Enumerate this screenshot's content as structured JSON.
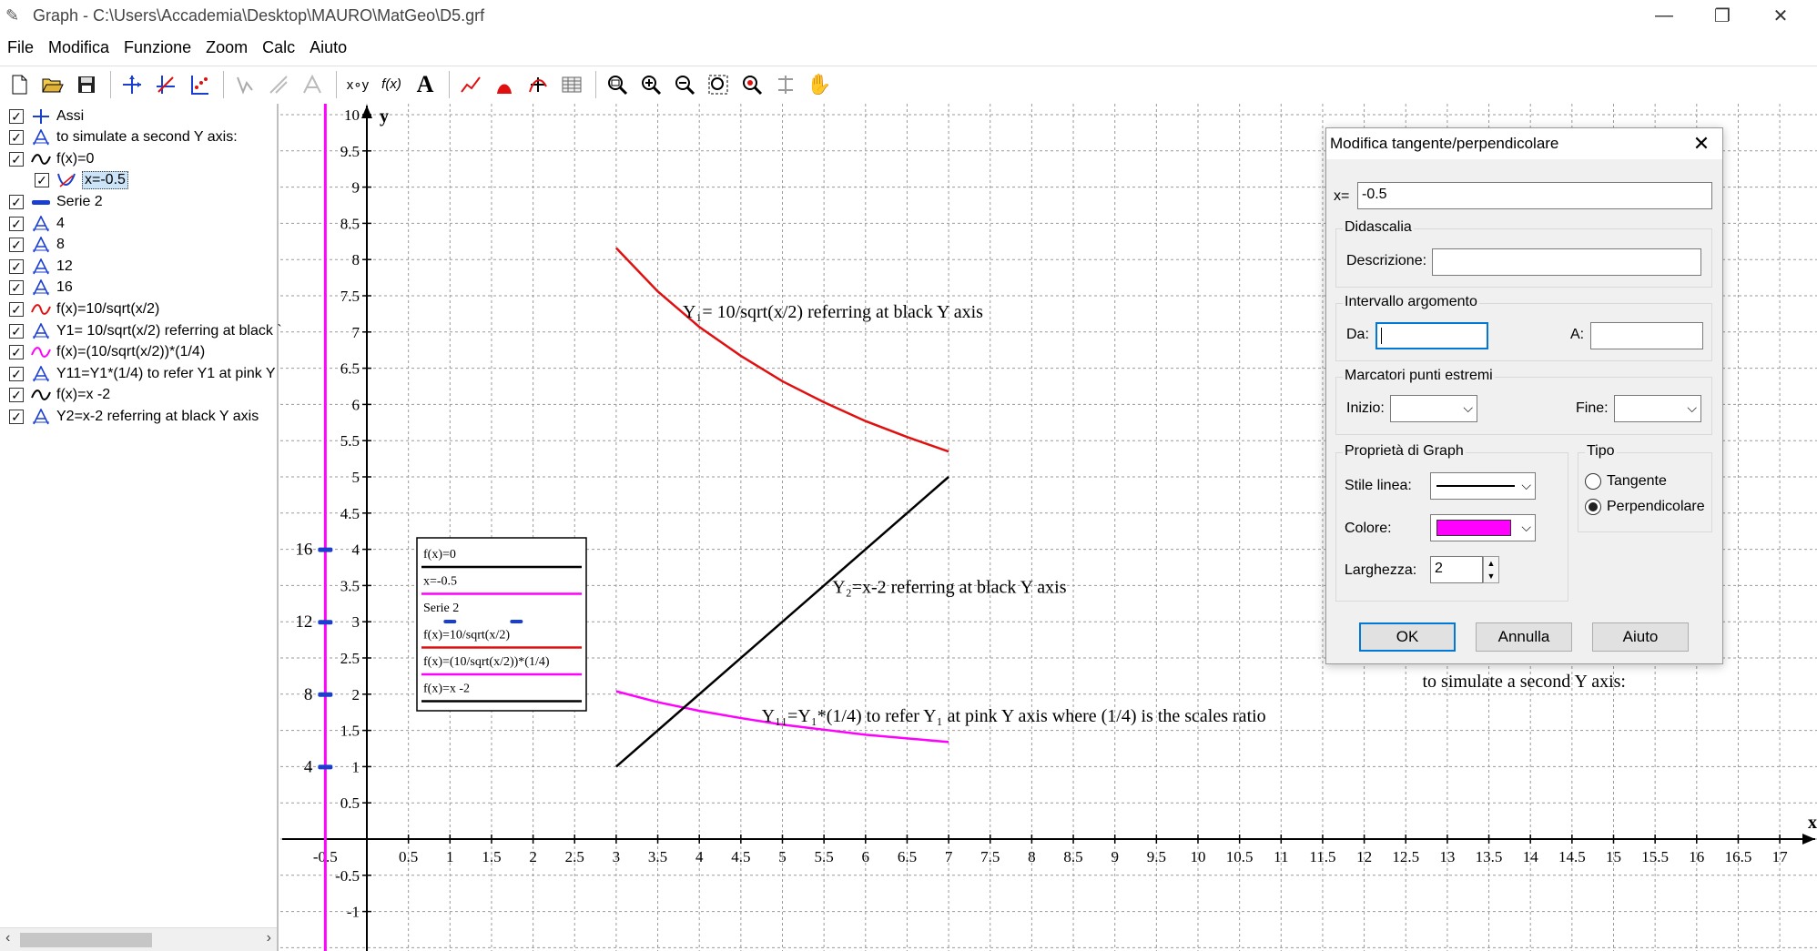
{
  "window": {
    "title": "Graph - C:\\Users\\Accademia\\Desktop\\MAURO\\MatGeo\\D5.grf"
  },
  "menu": [
    "File",
    "Modifica",
    "Funzione",
    "Zoom",
    "Calc",
    "Aiuto"
  ],
  "toolbar": {
    "buttons": [
      "new-icon",
      "open-icon",
      "save-icon",
      "axes-icon",
      "tangent-icon",
      "series-icon",
      "shading-off-icon",
      "relation-off-icon",
      "custom-off-icon",
      "xy-icon",
      "fx-icon",
      "text-icon",
      "line-tool-icon",
      "shade-icon",
      "insert-label-icon",
      "table-icon",
      "zoom-window-icon",
      "zoom-in-icon",
      "zoom-out-icon",
      "zoom-square-icon",
      "zoom-standard-icon",
      "zoom-fit-icon",
      "pan-icon"
    ],
    "xy_label": "x∘y",
    "fx_label": "f(x)",
    "text_label": "A"
  },
  "tree": [
    {
      "label": "Assi",
      "icon": "axes-icon",
      "color": "#1a3fd0",
      "checked": true,
      "indent": 0
    },
    {
      "label": "to simulate a second Y axis:",
      "icon": "label-icon",
      "color": "#1a3fd0",
      "checked": true,
      "indent": 0
    },
    {
      "label": "f(x)=0",
      "icon": "wave-icon",
      "color": "#000000",
      "checked": true,
      "indent": 0
    },
    {
      "label": "x=-0.5",
      "icon": "tangent-icon",
      "color": "#1a3fd0",
      "checked": true,
      "indent": 1
    },
    {
      "label": "Serie 2",
      "icon": "series-icon",
      "color": "#1a3fd0",
      "checked": true,
      "indent": 0
    },
    {
      "label": "4",
      "icon": "label-icon",
      "color": "#1a3fd0",
      "checked": true,
      "indent": 0
    },
    {
      "label": "8",
      "icon": "label-icon",
      "color": "#1a3fd0",
      "checked": true,
      "indent": 0
    },
    {
      "label": "12",
      "icon": "label-icon",
      "color": "#1a3fd0",
      "checked": true,
      "indent": 0
    },
    {
      "label": "16",
      "icon": "label-icon",
      "color": "#1a3fd0",
      "checked": true,
      "indent": 0
    },
    {
      "label": "f(x)=10/sqrt(x/2)",
      "icon": "wave-icon",
      "color": "#e01010",
      "checked": true,
      "indent": 0
    },
    {
      "label": "Y1= 10/sqrt(x/2) referring at black `",
      "icon": "label-icon",
      "color": "#1a3fd0",
      "checked": true,
      "indent": 0
    },
    {
      "label": "f(x)=(10/sqrt(x/2))*(1/4)",
      "icon": "wave-icon",
      "color": "#ff00ff",
      "checked": true,
      "indent": 0
    },
    {
      "label": "Y11=Y1*(1/4) to refer Y1 at pink Y",
      "icon": "label-icon",
      "color": "#1a3fd0",
      "checked": true,
      "indent": 0
    },
    {
      "label": "f(x)=x -2",
      "icon": "wave-icon",
      "color": "#000000",
      "checked": true,
      "indent": 0
    },
    {
      "label": "Y2=x-2 referring at black Y axis",
      "icon": "label-icon",
      "color": "#1a3fd0",
      "checked": true,
      "indent": 0
    }
  ],
  "chart_data": {
    "type": "line",
    "xlabel": "x",
    "ylabel": "y",
    "xlim": [
      -0.5,
      17
    ],
    "ylim": [
      -1,
      10
    ],
    "x_ticks": [
      "-0.5",
      "0.5",
      "1",
      "1.5",
      "2",
      "2.5",
      "3",
      "3.5",
      "4",
      "4.5",
      "5",
      "5.5",
      "6",
      "6.5",
      "7",
      "7.5",
      "8",
      "8.5",
      "9",
      "9.5",
      "10",
      "10.5",
      "11",
      "11.5",
      "12",
      "12.5",
      "13",
      "13.5",
      "14",
      "14.5",
      "15",
      "15.5",
      "16",
      "16.5",
      "17"
    ],
    "y_ticks": [
      "-1",
      "-0.5",
      "0.5",
      "1",
      "1.5",
      "2",
      "2.5",
      "3",
      "3.5",
      "4",
      "4.5",
      "5",
      "5.5",
      "6",
      "6.5",
      "7",
      "7.5",
      "8",
      "8.5",
      "9",
      "9.5",
      "10"
    ],
    "grid": true,
    "series": [
      {
        "name": "f(x)=10/sqrt(x/2)",
        "color": "#e01010",
        "x": [
          3,
          3.5,
          4,
          4.5,
          5,
          5.5,
          6,
          6.5,
          7
        ],
        "y": [
          8.16,
          7.56,
          7.07,
          6.67,
          6.32,
          6.03,
          5.77,
          5.55,
          5.35
        ]
      },
      {
        "name": "f(x)=(10/sqrt(x/2))*(1/4)",
        "color": "#ff00ff",
        "x": [
          3,
          3.5,
          4,
          4.5,
          5,
          5.5,
          6,
          6.5,
          7
        ],
        "y": [
          2.04,
          1.89,
          1.77,
          1.67,
          1.58,
          1.51,
          1.44,
          1.39,
          1.34
        ]
      },
      {
        "name": "f(x)=x -2",
        "color": "#000000",
        "x": [
          3,
          7
        ],
        "y": [
          1,
          5
        ]
      },
      {
        "name": "x=-0.5",
        "color": "#ff00ff",
        "vertical_x": -0.5
      }
    ],
    "series2_points": [
      {
        "x": -0.5,
        "y": 1,
        "label": "4"
      },
      {
        "x": -0.5,
        "y": 2,
        "label": "8"
      },
      {
        "x": -0.5,
        "y": 3,
        "label": "12"
      },
      {
        "x": -0.5,
        "y": 4,
        "label": "16"
      }
    ],
    "legend_series2_markers": [
      1,
      1.8
    ],
    "annotations": [
      {
        "text": "Y₁= 10/sqrt(x/2) referring at black Y axis",
        "x": 3.8,
        "y": 7.2
      },
      {
        "text": "Y₂=x-2 referring at black Y axis",
        "x": 5.6,
        "y": 3.4
      },
      {
        "text": "Y₁₁=Y₁*(1/4) to refer Y₁ at pink Y axis where (1/4) is the scales ratio",
        "x": 4.75,
        "y": 1.62
      },
      {
        "text": "to simulate a second Y axis:",
        "x": 12.7,
        "y": 2.1
      }
    ],
    "legend": {
      "placement": "left-middle",
      "entries": [
        {
          "label": "f(x)=0",
          "color": "#000000"
        },
        {
          "label": "x=-0.5",
          "color": "#ff00ff"
        },
        {
          "label": "Serie 2",
          "color": "#1a3fd0",
          "markers": true
        },
        {
          "label": "f(x)=10/sqrt(x/2)",
          "color": "#e01010"
        },
        {
          "label": "f(x)=(10/sqrt(x/2))*(1/4)",
          "color": "#ff00ff"
        },
        {
          "label": "f(x)=x -2",
          "color": "#000000"
        }
      ]
    }
  },
  "dialog": {
    "title": "Modifica tangente/perpendicolare",
    "x_label": "x=",
    "x_value": "-0.5",
    "didascalia": "Didascalia",
    "descrizione_label": "Descrizione:",
    "descrizione_value": "",
    "intervallo": "Intervallo argomento",
    "da_label": "Da:",
    "a_label": "A:",
    "marcatori": "Marcatori punti estremi",
    "inizio_label": "Inizio:",
    "fine_label": "Fine:",
    "proprieta": "Proprietà di Graph",
    "stile_label": "Stile linea:",
    "colore_label": "Colore:",
    "colore_value": "#ff00ff",
    "larghezza_label": "Larghezza:",
    "larghezza_value": "2",
    "tipo": "Tipo",
    "tangente": "Tangente",
    "perpendicolare": "Perpendicolare",
    "selected_tipo": "Perpendicolare",
    "ok": "OK",
    "annulla": "Annulla",
    "aiuto": "Aiuto"
  }
}
